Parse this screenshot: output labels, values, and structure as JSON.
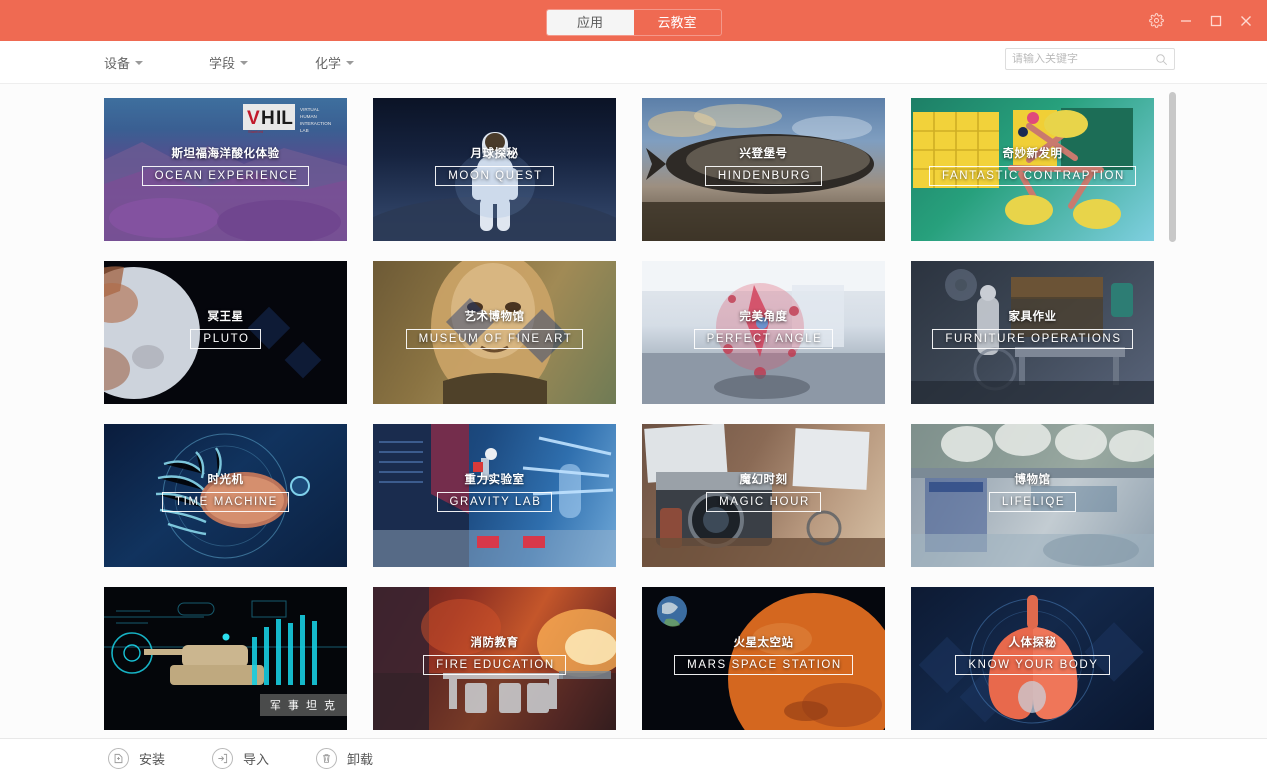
{
  "titlebar": {
    "tabs": [
      {
        "label": "应用",
        "active": true
      },
      {
        "label": "云教室",
        "active": false
      }
    ],
    "window_controls": [
      {
        "name": "settings-gear",
        "icon": "gear-icon"
      },
      {
        "name": "minimize",
        "icon": "minimize-icon"
      },
      {
        "name": "maximize",
        "icon": "maximize-icon"
      },
      {
        "name": "close",
        "icon": "close-icon"
      }
    ],
    "accent_color": "#ef6a52"
  },
  "filterbar": {
    "dropdowns": [
      {
        "label": "设备"
      },
      {
        "label": "学段"
      },
      {
        "label": "化学"
      }
    ],
    "search": {
      "placeholder": "请输入关键字",
      "value": "",
      "icon": "search-icon"
    }
  },
  "cards": [
    {
      "cn": "斯坦福海洋酸化体验",
      "en": "OCEAN EXPERIENCE",
      "theme": "ocean",
      "badge": "VHIL"
    },
    {
      "cn": "月球探秘",
      "en": "MOON QUEST",
      "theme": "moon"
    },
    {
      "cn": "兴登堡号",
      "en": "HINDENBURG",
      "theme": "hindenburg"
    },
    {
      "cn": "奇妙新发明",
      "en": "FANTASTIC CONTRAPTION",
      "theme": "contraption"
    },
    {
      "cn": "冥王星",
      "en": "PLUTO",
      "theme": "pluto"
    },
    {
      "cn": "艺术博物馆",
      "en": "MUSEUM OF FINE ART",
      "theme": "museum"
    },
    {
      "cn": "完美角度",
      "en": "PERFECT ANGLE",
      "theme": "angle"
    },
    {
      "cn": "家具作业",
      "en": "FURNITURE OPERATIONS",
      "theme": "furniture"
    },
    {
      "cn": "时光机",
      "en": "TIME MACHINE",
      "theme": "timemachine"
    },
    {
      "cn": "重力实验室",
      "en": "GRAVITY LAB",
      "theme": "gravity"
    },
    {
      "cn": "魔幻时刻",
      "en": "MAGIC HOUR",
      "theme": "magic"
    },
    {
      "cn": "博物馆",
      "en": "LIFELIQE",
      "theme": "lifeliqe"
    },
    {
      "cn": "",
      "en": "",
      "theme": "tank",
      "corner_tag": "军 事 坦 克"
    },
    {
      "cn": "消防教育",
      "en": "FIRE EDUCATION",
      "theme": "fire"
    },
    {
      "cn": "火星太空站",
      "en": "MARS SPACE STATION",
      "theme": "mars"
    },
    {
      "cn": "人体探秘",
      "en": "KNOW YOUR BODY",
      "theme": "body"
    }
  ],
  "bottombar": {
    "buttons": [
      {
        "label": "安装",
        "icon": "install-package-icon"
      },
      {
        "label": "导入",
        "icon": "import-arrow-icon"
      },
      {
        "label": "卸载",
        "icon": "trash-icon"
      }
    ]
  },
  "scrollbar": {
    "thumb_top": 0,
    "thumb_height": 150
  }
}
